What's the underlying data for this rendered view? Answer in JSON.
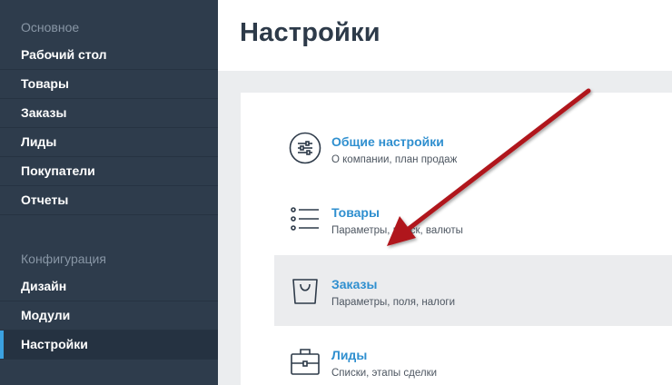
{
  "sidebar": {
    "section1": "Основное",
    "items1": [
      "Рабочий стол",
      "Товары",
      "Заказы",
      "Лиды",
      "Покупатели",
      "Отчеты"
    ],
    "section2": "Конфигурация",
    "items2": [
      "Дизайн",
      "Модули",
      "Настройки"
    ],
    "active": "Настройки",
    "accent": "#3ba1e0"
  },
  "header": {
    "title": "Настройки"
  },
  "settings": [
    {
      "title": "Общие настройки",
      "desc": "О компании, план продаж",
      "icon": "sliders-icon"
    },
    {
      "title": "Товары",
      "desc": "Параметры, поиск, валюты",
      "icon": "list-icon"
    },
    {
      "title": "Заказы",
      "desc": "Параметры, поля, налоги",
      "icon": "shopping-bag-icon"
    },
    {
      "title": "Лиды",
      "desc": "Списки, этапы сделки",
      "icon": "briefcase-icon"
    }
  ],
  "annotation": {
    "type": "arrow",
    "color": "#b0141c"
  }
}
